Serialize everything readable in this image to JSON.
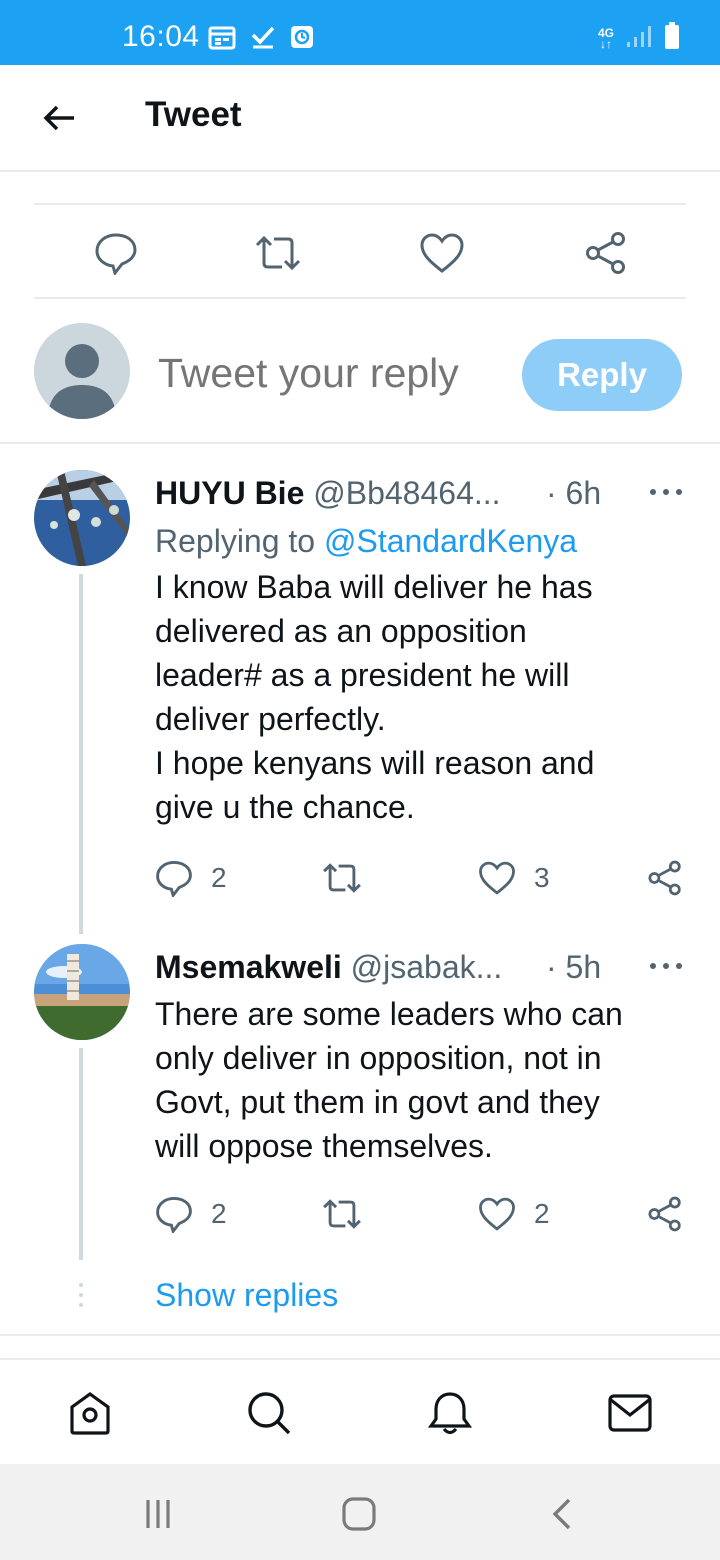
{
  "status_bar": {
    "time": "16:04",
    "network": "4G",
    "background_color": "#1da1f2"
  },
  "header": {
    "title": "Tweet",
    "back_icon": "arrow-left-icon"
  },
  "actions_bar": {
    "icons": [
      "reply-icon",
      "retweet-icon",
      "like-icon",
      "share-icon"
    ]
  },
  "compose": {
    "placeholder": "Tweet your reply",
    "reply_label": "Reply"
  },
  "replies": [
    {
      "name": "HUYU Bie",
      "handle": "@Bb48464...",
      "time": "· 6h",
      "replying_prefix": "Replying to ",
      "replying_to": "@StandardKenya",
      "text": "I know Baba will deliver he has\ndelivered  as an opposition\nleader# as a president  he will\ndeliver perfectly.\nI hope kenyans will reason and\ngive u the chance.",
      "reply_count": "2",
      "like_count": "3"
    },
    {
      "name": "Msemakweli",
      "handle": "@jsabak...",
      "time": "· 5h",
      "text": "There are some leaders who can\nonly deliver in opposition, not in\nGovt, put them in govt and they\nwill oppose themselves.",
      "reply_count": "2",
      "like_count": "2"
    }
  ],
  "show_replies": "Show replies",
  "bottom_nav": {
    "icons": [
      "home-icon",
      "search-icon",
      "notifications-icon",
      "messages-icon"
    ]
  },
  "system_nav": {
    "icons": [
      "recents-icon",
      "home-button-icon",
      "back-button-icon"
    ]
  },
  "colors": {
    "accent": "#1d9bf0",
    "reply_button": "#8ecdf7",
    "secondary_text": "#536471"
  }
}
